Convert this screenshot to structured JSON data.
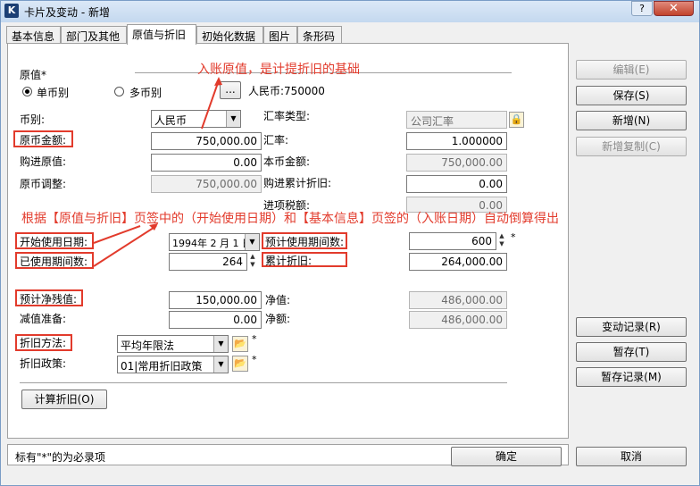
{
  "window": {
    "title": "卡片及变动 - 新增",
    "help": "?",
    "close": "✕",
    "icon": "K"
  },
  "tabs": [
    "基本信息",
    "部门及其他",
    "原值与折旧",
    "初始化数据",
    "图片",
    "条形码"
  ],
  "section": {
    "label": "原值*",
    "single_currency": "单币别",
    "multi_currency": "多币别",
    "browse": "...",
    "rmb_value": "人民币:750000"
  },
  "fields": {
    "currency_label": "币别:",
    "currency_value": "人民币",
    "rate_type_label": "汇率类型:",
    "rate_type_value": "公司汇率",
    "orig_amount_label": "原币金额:",
    "orig_amount_value": "750,000.00",
    "rate_label": "汇率:",
    "rate_value": "1.000000",
    "purchase_orig_label": "购进原值:",
    "purchase_orig_value": "0.00",
    "local_amount_label": "本币金额:",
    "local_amount_value": "750,000.00",
    "orig_adjust_label": "原币调整:",
    "orig_adjust_value": "750,000.00",
    "purchase_dep_label": "购进累计折旧:",
    "purchase_dep_value": "0.00",
    "input_tax_label": "进项税额:",
    "input_tax_value": "0.00",
    "start_date_label": "开始使用日期:",
    "start_date_value": "1994年 2 月 1 日",
    "expected_periods_label": "预计使用期间数:",
    "expected_periods_value": "600",
    "used_periods_label": "已使用期间数:",
    "used_periods_value": "264",
    "accum_dep_label": "累计折旧:",
    "accum_dep_value": "264,000.00",
    "residual_label": "预计净残值:",
    "residual_value": "150,000.00",
    "net_value_label": "净值:",
    "net_value_value": "486,000.00",
    "impairment_label": "减值准备:",
    "impairment_value": "0.00",
    "net_amount_label": "净额:",
    "net_amount_value": "486,000.00",
    "dep_method_label": "折旧方法:",
    "dep_method_value": "平均年限法",
    "dep_policy_label": "折旧政策:",
    "dep_policy_value": "01|常用折旧政策",
    "required_mark": "*"
  },
  "annotations": {
    "top": "入账原值，是计提折旧的基础",
    "middle": "根据【原值与折旧】页签中的（开始使用日期）和【基本信息】页签的（入账日期）自动倒算得出"
  },
  "buttons": {
    "calc": "计算折旧(O)",
    "edit": "编辑(E)",
    "save": "保存(S)",
    "add": "新增(N)",
    "copy": "新增复制(C)",
    "change_log": "变动记录(R)",
    "hold": "暂存(T)",
    "hold_log": "暂存记录(M)",
    "ok": "确定",
    "cancel": "取消"
  },
  "status": "标有\"*\"的为必录项",
  "colors": {
    "annotation": "#e23b2c"
  }
}
